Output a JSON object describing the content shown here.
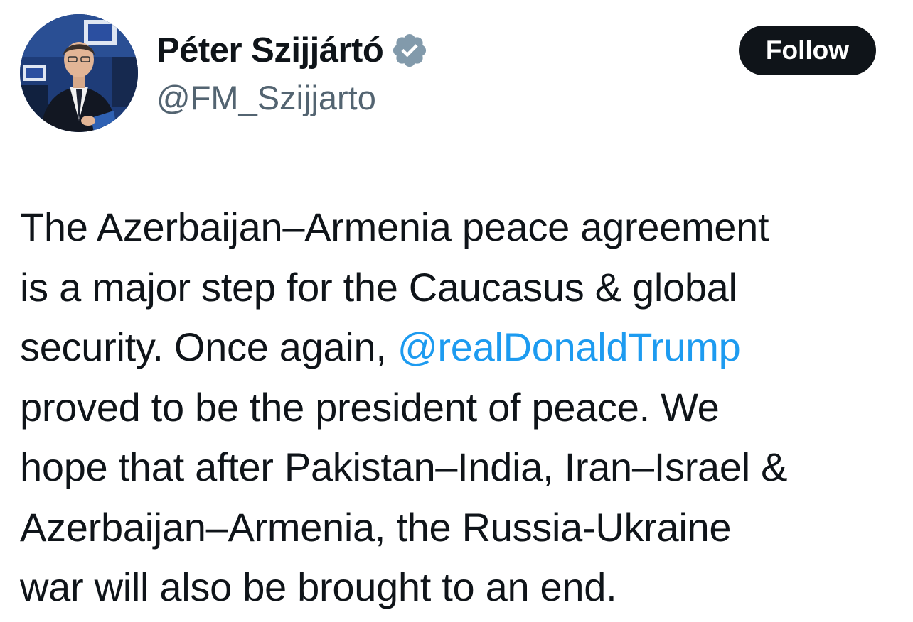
{
  "author": {
    "display_name": "Péter Szijjártó",
    "handle": "@FM_Szijjarto",
    "verified_icon": "verified-badge-icon",
    "avatar": "profile-photo"
  },
  "actions": {
    "follow_label": "Follow"
  },
  "tweet": {
    "line1": "The Azerbaijan–Armenia peace agreement",
    "line2": "is a major step for the Caucasus & global",
    "line3_before": "security. Once again, ",
    "line3_mention": "@realDonaldTrump",
    "line4": "proved to be the president of peace. We",
    "line5": "hope that after Pakistan–India, Iran–Israel &",
    "line6": "Azerbaijan–Armenia, the Russia-Ukraine",
    "line7": "war will also be brought to an end."
  },
  "colors": {
    "text": "#0f1419",
    "secondary_text": "#536471",
    "mention": "#1d9bf0",
    "follow_button_bg": "#0f1419",
    "verified_badge": "#829aab"
  }
}
